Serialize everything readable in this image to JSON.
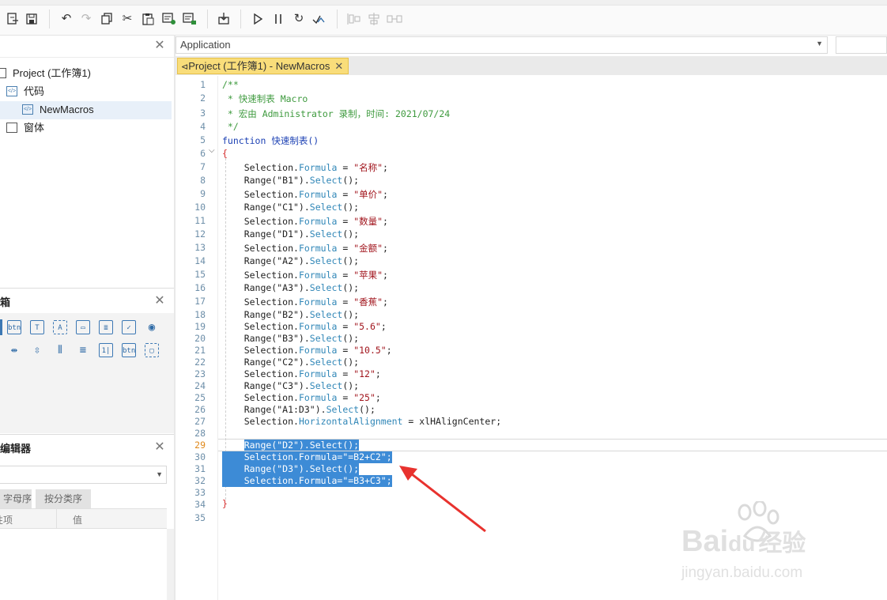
{
  "toolbar": {
    "icons": [
      "export-icon",
      "save-icon",
      "undo-icon",
      "redo-icon",
      "copy-icon",
      "cut-icon",
      "paste-icon",
      "comment-icon",
      "uncomment-icon",
      "import-icon",
      "run-icon",
      "pause-icon",
      "reset-icon",
      "debug-icon",
      "align-left-icon",
      "align-center-icon",
      "distribute-icon"
    ]
  },
  "project_panel": {
    "root": "Project (工作簿1)",
    "items": [
      {
        "label": "代码",
        "indent": 1
      },
      {
        "label": "NewMacros",
        "indent": 2,
        "selected": true
      },
      {
        "label": "窗体",
        "indent": 1
      }
    ]
  },
  "toolbox_panel": {
    "title": "箱"
  },
  "property_panel": {
    "title": "编辑器",
    "tabs": [
      "字母序",
      "按分类序"
    ],
    "columns": [
      "属性项",
      "值"
    ]
  },
  "editor": {
    "object_select": "Application",
    "tab_label": "Project (工作簿1) - NewMacros",
    "active_line": "29",
    "line_numbers": [
      "1",
      "2",
      "3",
      "4",
      "5",
      "6",
      "7",
      "8",
      "9",
      "10",
      "11",
      "12",
      "13",
      "14",
      "15",
      "16",
      "17",
      "18",
      "19",
      "20",
      "21",
      "22",
      "23",
      "24",
      "25",
      "26",
      "27",
      "28",
      "29",
      "30",
      "31",
      "32",
      "33",
      "34",
      "35"
    ],
    "code": {
      "l1": "/**",
      "l2": " * 快速制表 Macro",
      "l3": " * 宏由 Administrator 录制，时间: 2021/07/24",
      "l4": " */",
      "l5_kw": "function",
      "l5_name": " 快速制表()",
      "l6": "{",
      "l7_a": "    Selection.",
      "l7_p": "Formula",
      "l7_b": " = ",
      "l7_s": "\"名称\"",
      "l7_c": ";",
      "l8_a": "    Range(\"B1\").",
      "l8_p": "Select",
      "l8_c": "();",
      "l9_a": "    Selection.",
      "l9_p": "Formula",
      "l9_b": " = ",
      "l9_s": "\"单价\"",
      "l9_c": ";",
      "l10_a": "    Range(\"C1\").",
      "l10_p": "Select",
      "l10_c": "();",
      "l11_a": "    Selection.",
      "l11_p": "Formula",
      "l11_b": " = ",
      "l11_s": "\"数量\"",
      "l11_c": ";",
      "l12_a": "    Range(\"D1\").",
      "l12_p": "Select",
      "l12_c": "();",
      "l13_a": "    Selection.",
      "l13_p": "Formula",
      "l13_b": " = ",
      "l13_s": "\"金额\"",
      "l13_c": ";",
      "l14_a": "    Range(\"A2\").",
      "l14_p": "Select",
      "l14_c": "();",
      "l15_a": "    Selection.",
      "l15_p": "Formula",
      "l15_b": " = ",
      "l15_s": "\"苹果\"",
      "l15_c": ";",
      "l16_a": "    Range(\"A3\").",
      "l16_p": "Select",
      "l16_c": "();",
      "l17_a": "    Selection.",
      "l17_p": "Formula",
      "l17_b": " = ",
      "l17_s": "\"香蕉\"",
      "l17_c": ";",
      "l18_a": "    Range(\"B2\").",
      "l18_p": "Select",
      "l18_c": "();",
      "l19_a": "    Selection.",
      "l19_p": "Formula",
      "l19_b": " = ",
      "l19_s": "\"5.6\"",
      "l19_c": ";",
      "l20_a": "    Range(\"B3\").",
      "l20_p": "Select",
      "l20_c": "();",
      "l21_a": "    Selection.",
      "l21_p": "Formula",
      "l21_b": " = ",
      "l21_s": "\"10.5\"",
      "l21_c": ";",
      "l22_a": "    Range(\"C2\").",
      "l22_p": "Select",
      "l22_c": "();",
      "l23_a": "    Selection.",
      "l23_p": "Formula",
      "l23_b": " = ",
      "l23_s": "\"12\"",
      "l23_c": ";",
      "l24_a": "    Range(\"C3\").",
      "l24_p": "Select",
      "l24_c": "();",
      "l25_a": "    Selection.",
      "l25_p": "Formula",
      "l25_b": " = ",
      "l25_s": "\"25\"",
      "l25_c": ";",
      "l26_a": "    Range(\"A1:D3\").",
      "l26_p": "Select",
      "l26_c": "();",
      "l27_a": "    Selection.",
      "l27_p": "HorizontalAlignment",
      "l27_c": " = xlHAlignCenter;",
      "l29_a": "    ",
      "l29_s": "Range(\"D2\").Select();",
      "l30": "    Selection.Formula=\"=B2+C2\";",
      "l31": "    Range(\"D3\").Select();",
      "l32": "    Selection.Formula=\"=B3+C3\";",
      "l34": "}"
    }
  },
  "watermark": {
    "brand": "Bai",
    "brand2": "du",
    "cn": "经验",
    "url": "jingyan.baidu.com"
  },
  "colors": {
    "selection": "#3d8bd6",
    "tab_active": "#f9dd7a",
    "arrow": "#e8322e"
  }
}
